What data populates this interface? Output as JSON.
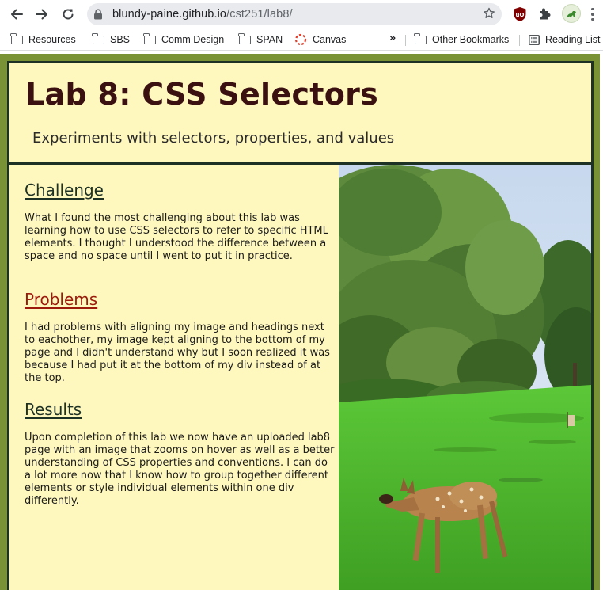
{
  "browser": {
    "url_host": "blundy-paine.github.io",
    "url_path": "/cst251/lab8/",
    "bookmarks": [
      {
        "label": "Resources",
        "icon": "folder-icon"
      },
      {
        "label": "SBS",
        "icon": "folder-icon"
      },
      {
        "label": "Comm Design",
        "icon": "folder-icon"
      },
      {
        "label": "SPAN",
        "icon": "folder-icon"
      },
      {
        "label": "Canvas",
        "icon": "canvas-icon"
      },
      {
        "label": "Other Bookmarks",
        "icon": "folder-icon"
      },
      {
        "label": "Reading List",
        "icon": "reading-list-icon"
      }
    ],
    "overflow_label": "»",
    "extension_badge": "uO"
  },
  "page": {
    "title": "Lab 8: CSS Selectors",
    "subtitle": "Experiments with selectors, properties, and values",
    "sections": [
      {
        "heading": "Challenge",
        "body": "What I found the most challenging about this lab was learning how to use CSS selectors to refer to specific HTML elements. I thought I understood the difference between a space and no space until I went to put it in practice."
      },
      {
        "heading": "Problems",
        "body": "I had problems with aligning my image and headings next to eachother, my image kept aligning to the bottom of my page and I didn't understand why but I soon realized it was because I had put it at the bottom of my div instead of at the top."
      },
      {
        "heading": "Results",
        "body": "Upon completion of this lab we now have an uploaded lab8 page with an image that zooms on hover as well as a better understanding of CSS properties and conventions. I can do a lot more now that I know how to group together different elements or style individual elements within one div differently."
      }
    ]
  },
  "colors": {
    "page_background": "#7a9236",
    "box_background": "#fff8be",
    "border": "#1d3125",
    "title": "#3a1010",
    "problems_heading": "#9c1a0c"
  }
}
